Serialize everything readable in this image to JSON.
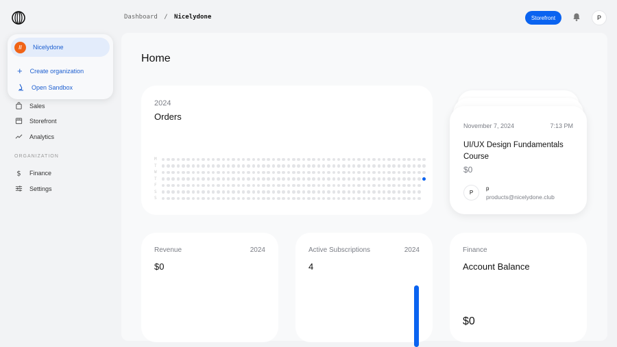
{
  "breadcrumb": {
    "parent": "Dashboard",
    "separator": "/",
    "current": "Nicelydone"
  },
  "header": {
    "storefront_label": "Storefront",
    "avatar_initial": "P"
  },
  "org_menu": {
    "current_org": "Nicelydone",
    "create_label": "Create organization",
    "sandbox_label": "Open Sandbox"
  },
  "sidebar": {
    "items": [
      {
        "label": "Sales"
      },
      {
        "label": "Storefront"
      },
      {
        "label": "Analytics"
      }
    ],
    "section_label": "ORGANIZATION",
    "org_items": [
      {
        "label": "Finance"
      },
      {
        "label": "Settings"
      }
    ]
  },
  "page_title": "Home",
  "orders": {
    "year": "2024",
    "title": "Orders",
    "day_labels": [
      "M",
      "T",
      "W",
      "T",
      "F",
      "S",
      "S"
    ],
    "weeks": 53,
    "active_day": {
      "week": 53,
      "day": 4
    }
  },
  "order_card": {
    "date": "November 7, 2024",
    "time": "7:13 PM",
    "product": "UI/UX Design Fundamentals Course",
    "price": "$0",
    "customer_initial": "P",
    "customer_name": "p",
    "customer_email": "products@nicelydone.club"
  },
  "revenue": {
    "label": "Revenue",
    "year": "2024",
    "value": "$0"
  },
  "subscriptions": {
    "label": "Active Subscriptions",
    "year": "2024",
    "value": "4"
  },
  "finance": {
    "label": "Finance",
    "title": "Account Balance",
    "value": "$0"
  },
  "colors": {
    "accent": "#0a63f0",
    "org_logo": "#f06418"
  }
}
